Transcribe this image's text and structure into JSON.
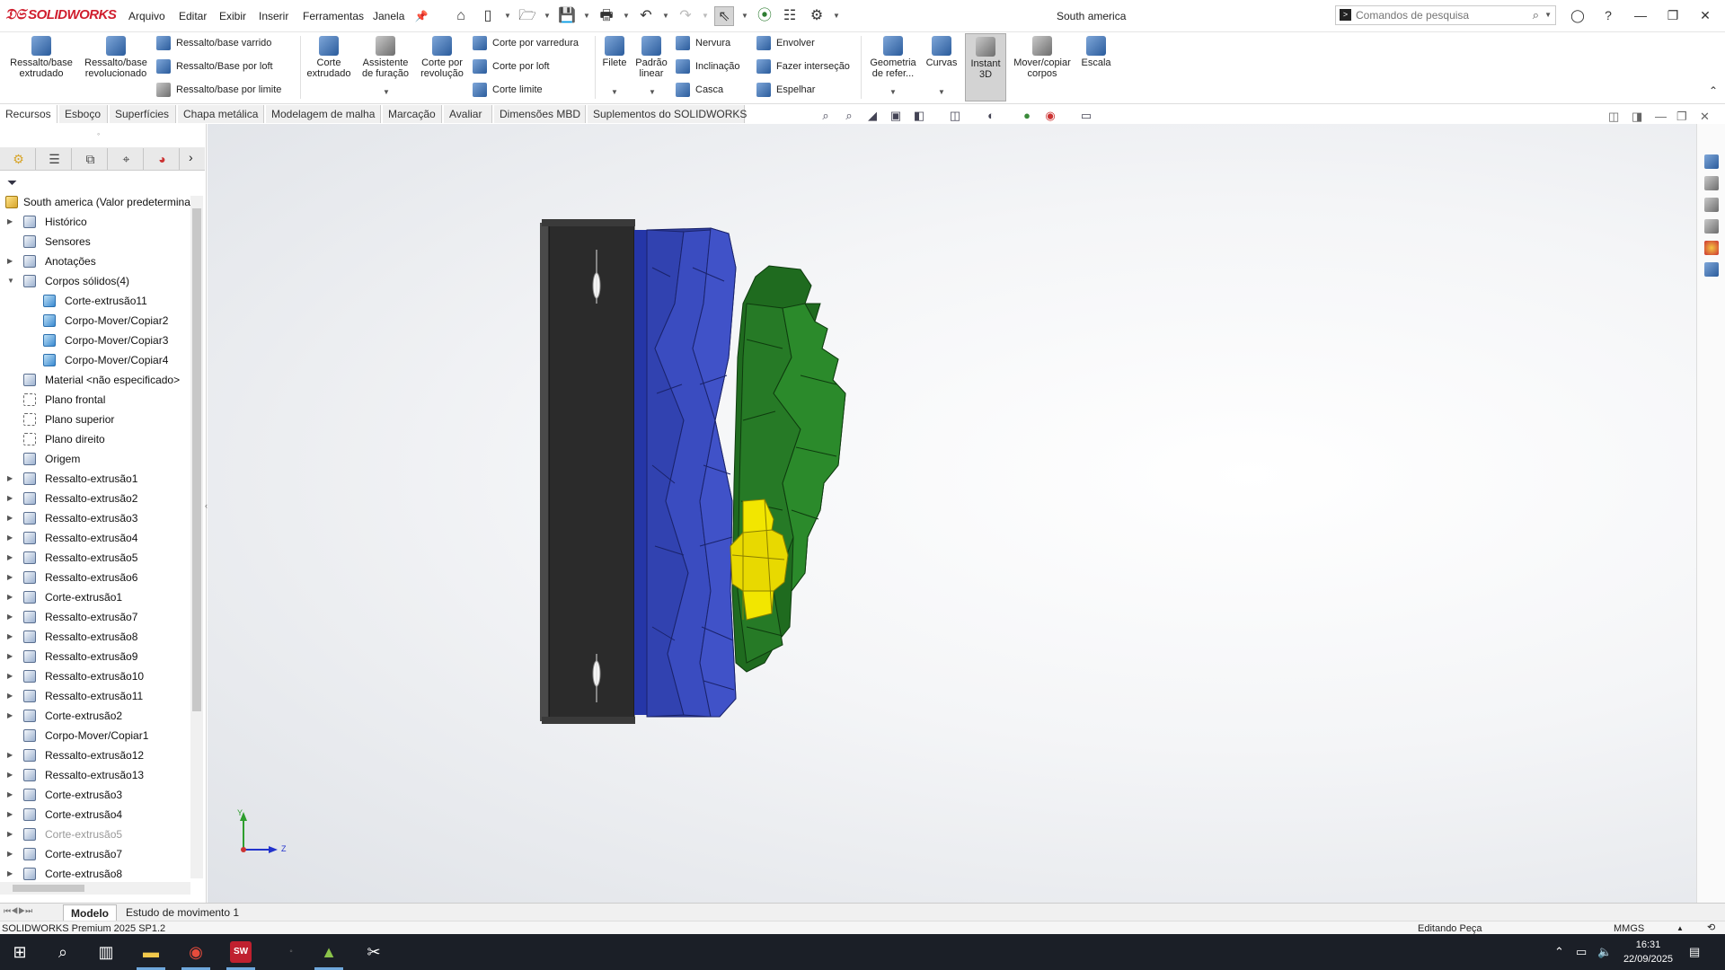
{
  "app": {
    "logo": "SOLIDWORKS",
    "document_title": "South america",
    "menus": [
      "Arquivo",
      "Editar",
      "Exibir",
      "Inserir",
      "Ferramentas",
      "Janela"
    ],
    "search_placeholder": "Comandos de pesquisa"
  },
  "ribbon": {
    "big_buttons": [
      {
        "label": "Ressalto/base extrudado",
        "icon": "extrude-boss-icon"
      },
      {
        "label": "Ressalto/base revolucionado",
        "icon": "revolve-boss-icon"
      },
      {
        "label": "Corte extrudado",
        "icon": "extrude-cut-icon"
      },
      {
        "label": "Assistente de furação",
        "icon": "hole-wizard-icon"
      },
      {
        "label": "Corte por revolução",
        "icon": "revolve-cut-icon"
      },
      {
        "label": "Filete",
        "icon": "fillet-icon"
      },
      {
        "label": "Padrão linear",
        "icon": "linear-pattern-icon"
      },
      {
        "label": "Geometria de refer...",
        "icon": "reference-geometry-icon"
      },
      {
        "label": "Curvas",
        "icon": "curves-icon"
      },
      {
        "label": "Instant 3D",
        "icon": "instant3d-icon"
      },
      {
        "label": "Mover/copiar corpos",
        "icon": "move-copy-bodies-icon"
      },
      {
        "label": "Escala",
        "icon": "scale-icon"
      }
    ],
    "small_buttons": [
      {
        "label": "Ressalto/base varrido",
        "icon": "swept-boss-icon"
      },
      {
        "label": "Ressalto/Base por loft",
        "icon": "loft-boss-icon"
      },
      {
        "label": "Ressalto/base por limite",
        "icon": "boundary-boss-icon"
      },
      {
        "label": "Corte por varredura",
        "icon": "swept-cut-icon"
      },
      {
        "label": "Corte por loft",
        "icon": "loft-cut-icon"
      },
      {
        "label": "Corte limite",
        "icon": "boundary-cut-icon"
      },
      {
        "label": "Nervura",
        "icon": "rib-icon"
      },
      {
        "label": "Inclinação",
        "icon": "draft-icon"
      },
      {
        "label": "Casca",
        "icon": "shell-icon"
      },
      {
        "label": "Envolver",
        "icon": "wrap-icon"
      },
      {
        "label": "Fazer interseção",
        "icon": "intersect-icon"
      },
      {
        "label": "Espelhar",
        "icon": "mirror-icon"
      }
    ]
  },
  "tabs": [
    "Recursos",
    "Esboço",
    "Superfícies",
    "Chapa metálica",
    "Modelagem de malha",
    "Marcação",
    "Avaliar",
    "Dimensões MBD",
    "Suplementos do SOLIDWORKS"
  ],
  "active_tab": "Recursos",
  "feature_tree": {
    "root": "South america  (Valor predetermina",
    "items": [
      {
        "label": "Histórico",
        "expandable": true,
        "level": 1,
        "kind": "folder"
      },
      {
        "label": "Sensores",
        "expandable": false,
        "level": 1,
        "kind": "folder"
      },
      {
        "label": "Anotações",
        "expandable": true,
        "level": 1,
        "kind": "folder"
      },
      {
        "label": "Corpos sólidos(4)",
        "expandable": true,
        "expanded": true,
        "level": 1,
        "kind": "folder"
      },
      {
        "label": "Corte-extrusão11",
        "expandable": false,
        "level": 2,
        "kind": "body"
      },
      {
        "label": "Corpo-Mover/Copiar2",
        "expandable": false,
        "level": 2,
        "kind": "body"
      },
      {
        "label": "Corpo-Mover/Copiar3",
        "expandable": false,
        "level": 2,
        "kind": "body"
      },
      {
        "label": "Corpo-Mover/Copiar4",
        "expandable": false,
        "level": 2,
        "kind": "body"
      },
      {
        "label": "Material <não especificado>",
        "expandable": false,
        "level": 1,
        "kind": "material"
      },
      {
        "label": "Plano frontal",
        "expandable": false,
        "level": 1,
        "kind": "plane"
      },
      {
        "label": "Plano superior",
        "expandable": false,
        "level": 1,
        "kind": "plane"
      },
      {
        "label": "Plano direito",
        "expandable": false,
        "level": 1,
        "kind": "plane"
      },
      {
        "label": "Origem",
        "expandable": false,
        "level": 1,
        "kind": "origin"
      },
      {
        "label": "Ressalto-extrusão1",
        "expandable": true,
        "level": 1,
        "kind": "feature"
      },
      {
        "label": "Ressalto-extrusão2",
        "expandable": true,
        "level": 1,
        "kind": "feature"
      },
      {
        "label": "Ressalto-extrusão3",
        "expandable": true,
        "level": 1,
        "kind": "feature"
      },
      {
        "label": "Ressalto-extrusão4",
        "expandable": true,
        "level": 1,
        "kind": "feature"
      },
      {
        "label": "Ressalto-extrusão5",
        "expandable": true,
        "level": 1,
        "kind": "feature"
      },
      {
        "label": "Ressalto-extrusão6",
        "expandable": true,
        "level": 1,
        "kind": "feature"
      },
      {
        "label": "Corte-extrusão1",
        "expandable": true,
        "level": 1,
        "kind": "feature"
      },
      {
        "label": "Ressalto-extrusão7",
        "expandable": true,
        "level": 1,
        "kind": "feature"
      },
      {
        "label": "Ressalto-extrusão8",
        "expandable": true,
        "level": 1,
        "kind": "feature"
      },
      {
        "label": "Ressalto-extrusão9",
        "expandable": true,
        "level": 1,
        "kind": "feature"
      },
      {
        "label": "Ressalto-extrusão10",
        "expandable": true,
        "level": 1,
        "kind": "feature"
      },
      {
        "label": "Ressalto-extrusão11",
        "expandable": true,
        "level": 1,
        "kind": "feature"
      },
      {
        "label": "Corte-extrusão2",
        "expandable": true,
        "level": 1,
        "kind": "feature"
      },
      {
        "label": "Corpo-Mover/Copiar1",
        "expandable": false,
        "level": 1,
        "kind": "move"
      },
      {
        "label": "Ressalto-extrusão12",
        "expandable": true,
        "level": 1,
        "kind": "feature"
      },
      {
        "label": "Ressalto-extrusão13",
        "expandable": true,
        "level": 1,
        "kind": "feature"
      },
      {
        "label": "Corte-extrusão3",
        "expandable": true,
        "level": 1,
        "kind": "feature"
      },
      {
        "label": "Corte-extrusão4",
        "expandable": true,
        "level": 1,
        "kind": "feature"
      },
      {
        "label": "Corte-extrusão5",
        "expandable": true,
        "level": 1,
        "kind": "feature",
        "dimmed": true
      },
      {
        "label": "Corte-extrusão7",
        "expandable": true,
        "level": 1,
        "kind": "feature"
      },
      {
        "label": "Corte-extrusão8",
        "expandable": true,
        "level": 1,
        "kind": "feature"
      }
    ]
  },
  "model_tabs": [
    "Modelo",
    "Estudo de movimento 1"
  ],
  "status": {
    "product": "SOLIDWORKS Premium 2025 SP1.2",
    "mode": "Editando Peça",
    "units": "MMGS"
  },
  "taskbar": {
    "time": "16:31",
    "date": "22/09/2025"
  },
  "triad": {
    "y": "Y",
    "z": "Z"
  },
  "colors": {
    "frame": "#2b2b2b",
    "blue_body": "#2f3e9e",
    "green_body": "#1f6b1f",
    "yellow_body": "#f2e600",
    "accent_red": "#d01e2e"
  }
}
